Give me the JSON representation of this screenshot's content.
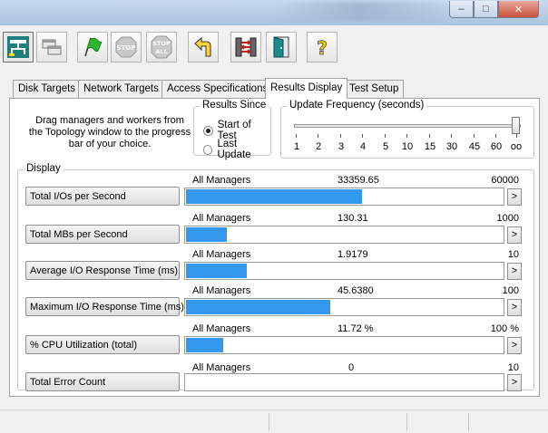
{
  "window": {
    "minimize": "–",
    "maximize": "□",
    "close": "✕"
  },
  "toolbar": [
    {
      "name": "topology-button",
      "icon": "topology-icon"
    },
    {
      "name": "workers-button",
      "icon": "workers-icon"
    },
    {
      "name": "start-button",
      "icon": "green-flag-icon"
    },
    {
      "name": "stop-button",
      "icon": "stop-sign-icon",
      "label": "STOP"
    },
    {
      "name": "stop-all-button",
      "icon": "stop-all-icon",
      "label": "STOP ALL"
    },
    {
      "name": "reset-button",
      "icon": "back-arrow-icon"
    },
    {
      "name": "network-button",
      "icon": "network-icon"
    },
    {
      "name": "exit-button",
      "icon": "exit-door-icon"
    },
    {
      "name": "help-button",
      "icon": "help-icon",
      "label": "?"
    }
  ],
  "tabs": [
    "Disk Targets",
    "Network Targets",
    "Access Specifications",
    "Results Display",
    "Test Setup"
  ],
  "active_tab": "Results Display",
  "hint": "Drag managers and workers from the Topology window to the progress bar of your choice.",
  "results_since": {
    "label": "Results Since",
    "options": [
      "Start of Test",
      "Last Update"
    ],
    "selected": "Start of Test"
  },
  "update_frequency": {
    "label": "Update Frequency (seconds)",
    "ticks": [
      "1",
      "2",
      "3",
      "4",
      "5",
      "10",
      "15",
      "30",
      "45",
      "60",
      "oo"
    ],
    "selected": "oo"
  },
  "display": {
    "label": "Display",
    "rows": [
      {
        "button": "Total I/Os per Second",
        "source": "All Managers",
        "value": "33359.65",
        "max": "60000",
        "fraction": 0.556
      },
      {
        "button": "Total MBs per Second",
        "source": "All Managers",
        "value": "130.31",
        "max": "1000",
        "fraction": 0.1303
      },
      {
        "button": "Average I/O Response Time (ms)",
        "source": "All Managers",
        "value": "1.9179",
        "max": "10",
        "fraction": 0.1918
      },
      {
        "button": "Maximum I/O Response Time (ms)",
        "source": "All Managers",
        "value": "45.6380",
        "max": "100",
        "fraction": 0.4564
      },
      {
        "button": "% CPU Utilization (total)",
        "source": "All Managers",
        "value": "11.72 %",
        "max": "100 %",
        "fraction": 0.1172
      },
      {
        "button": "Total Error Count",
        "source": "All Managers",
        "value": "0",
        "max": "10",
        "fraction": 0
      }
    ],
    "arrow_label": ">"
  },
  "colors": {
    "bar_fill": "#3399ee",
    "panel_bg": "#ffffff",
    "chrome": "#f0f0f0"
  }
}
